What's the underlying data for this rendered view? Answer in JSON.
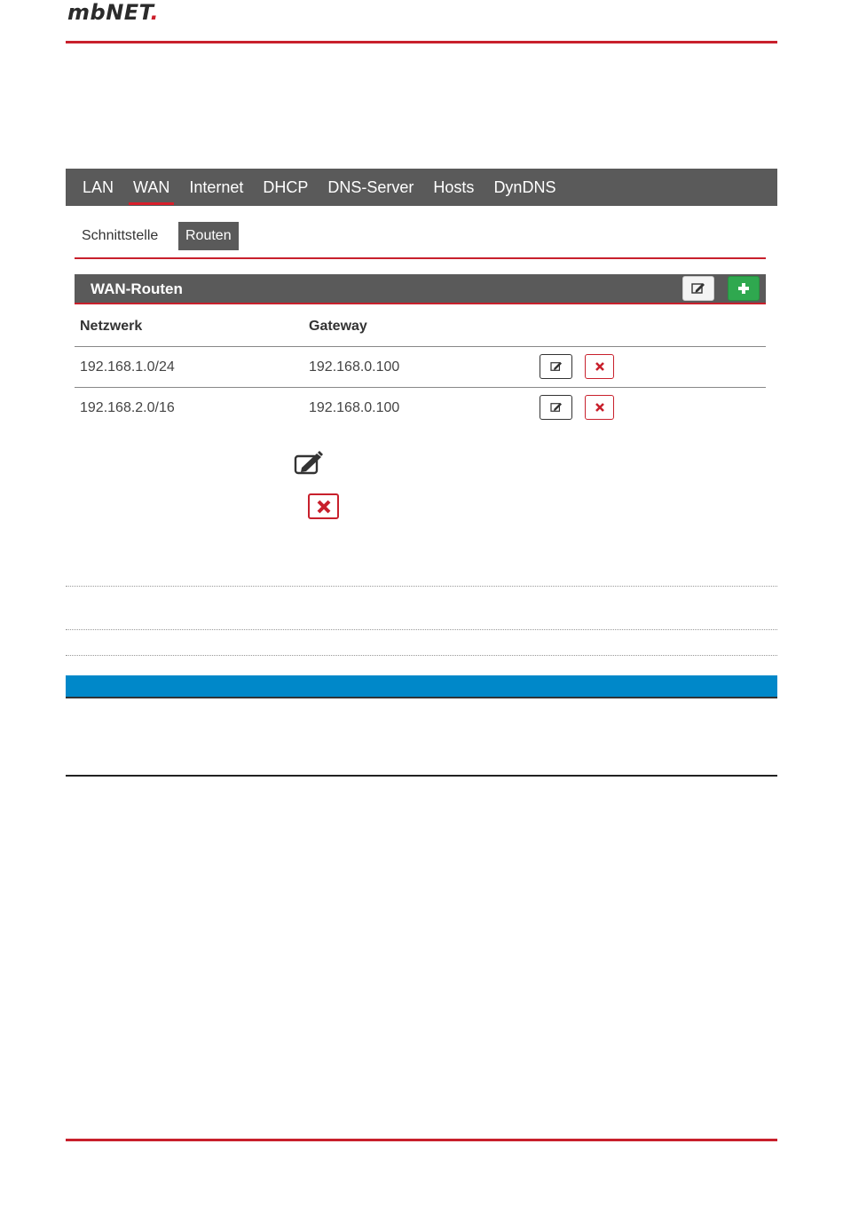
{
  "brand": {
    "name": "mbNET",
    "dot": "."
  },
  "main_nav": {
    "tabs": [
      {
        "label": "LAN"
      },
      {
        "label": "WAN"
      },
      {
        "label": "Internet"
      },
      {
        "label": "DHCP"
      },
      {
        "label": "DNS-Server"
      },
      {
        "label": "Hosts"
      },
      {
        "label": "DynDNS"
      }
    ],
    "active": "WAN"
  },
  "sub_nav": {
    "tabs": [
      {
        "label": "Schnittstelle"
      },
      {
        "label": "Routen"
      }
    ],
    "active": "Routen"
  },
  "panel": {
    "title": "WAN-Routen",
    "columns": [
      "Netzwerk",
      "Gateway"
    ],
    "rows": [
      {
        "network": "192.168.1.0/24",
        "gateway": "192.168.0.100"
      },
      {
        "network": "192.168.2.0/16",
        "gateway": "192.168.0.100"
      }
    ]
  },
  "icons": {
    "edit": "edit-icon",
    "add": "plus-icon",
    "delete": "delete-icon"
  },
  "colors": {
    "accent_red": "#c8202c",
    "nav_gray": "#5a5a5a",
    "add_green": "#2fa84f",
    "info_blue": "#0088c9"
  }
}
